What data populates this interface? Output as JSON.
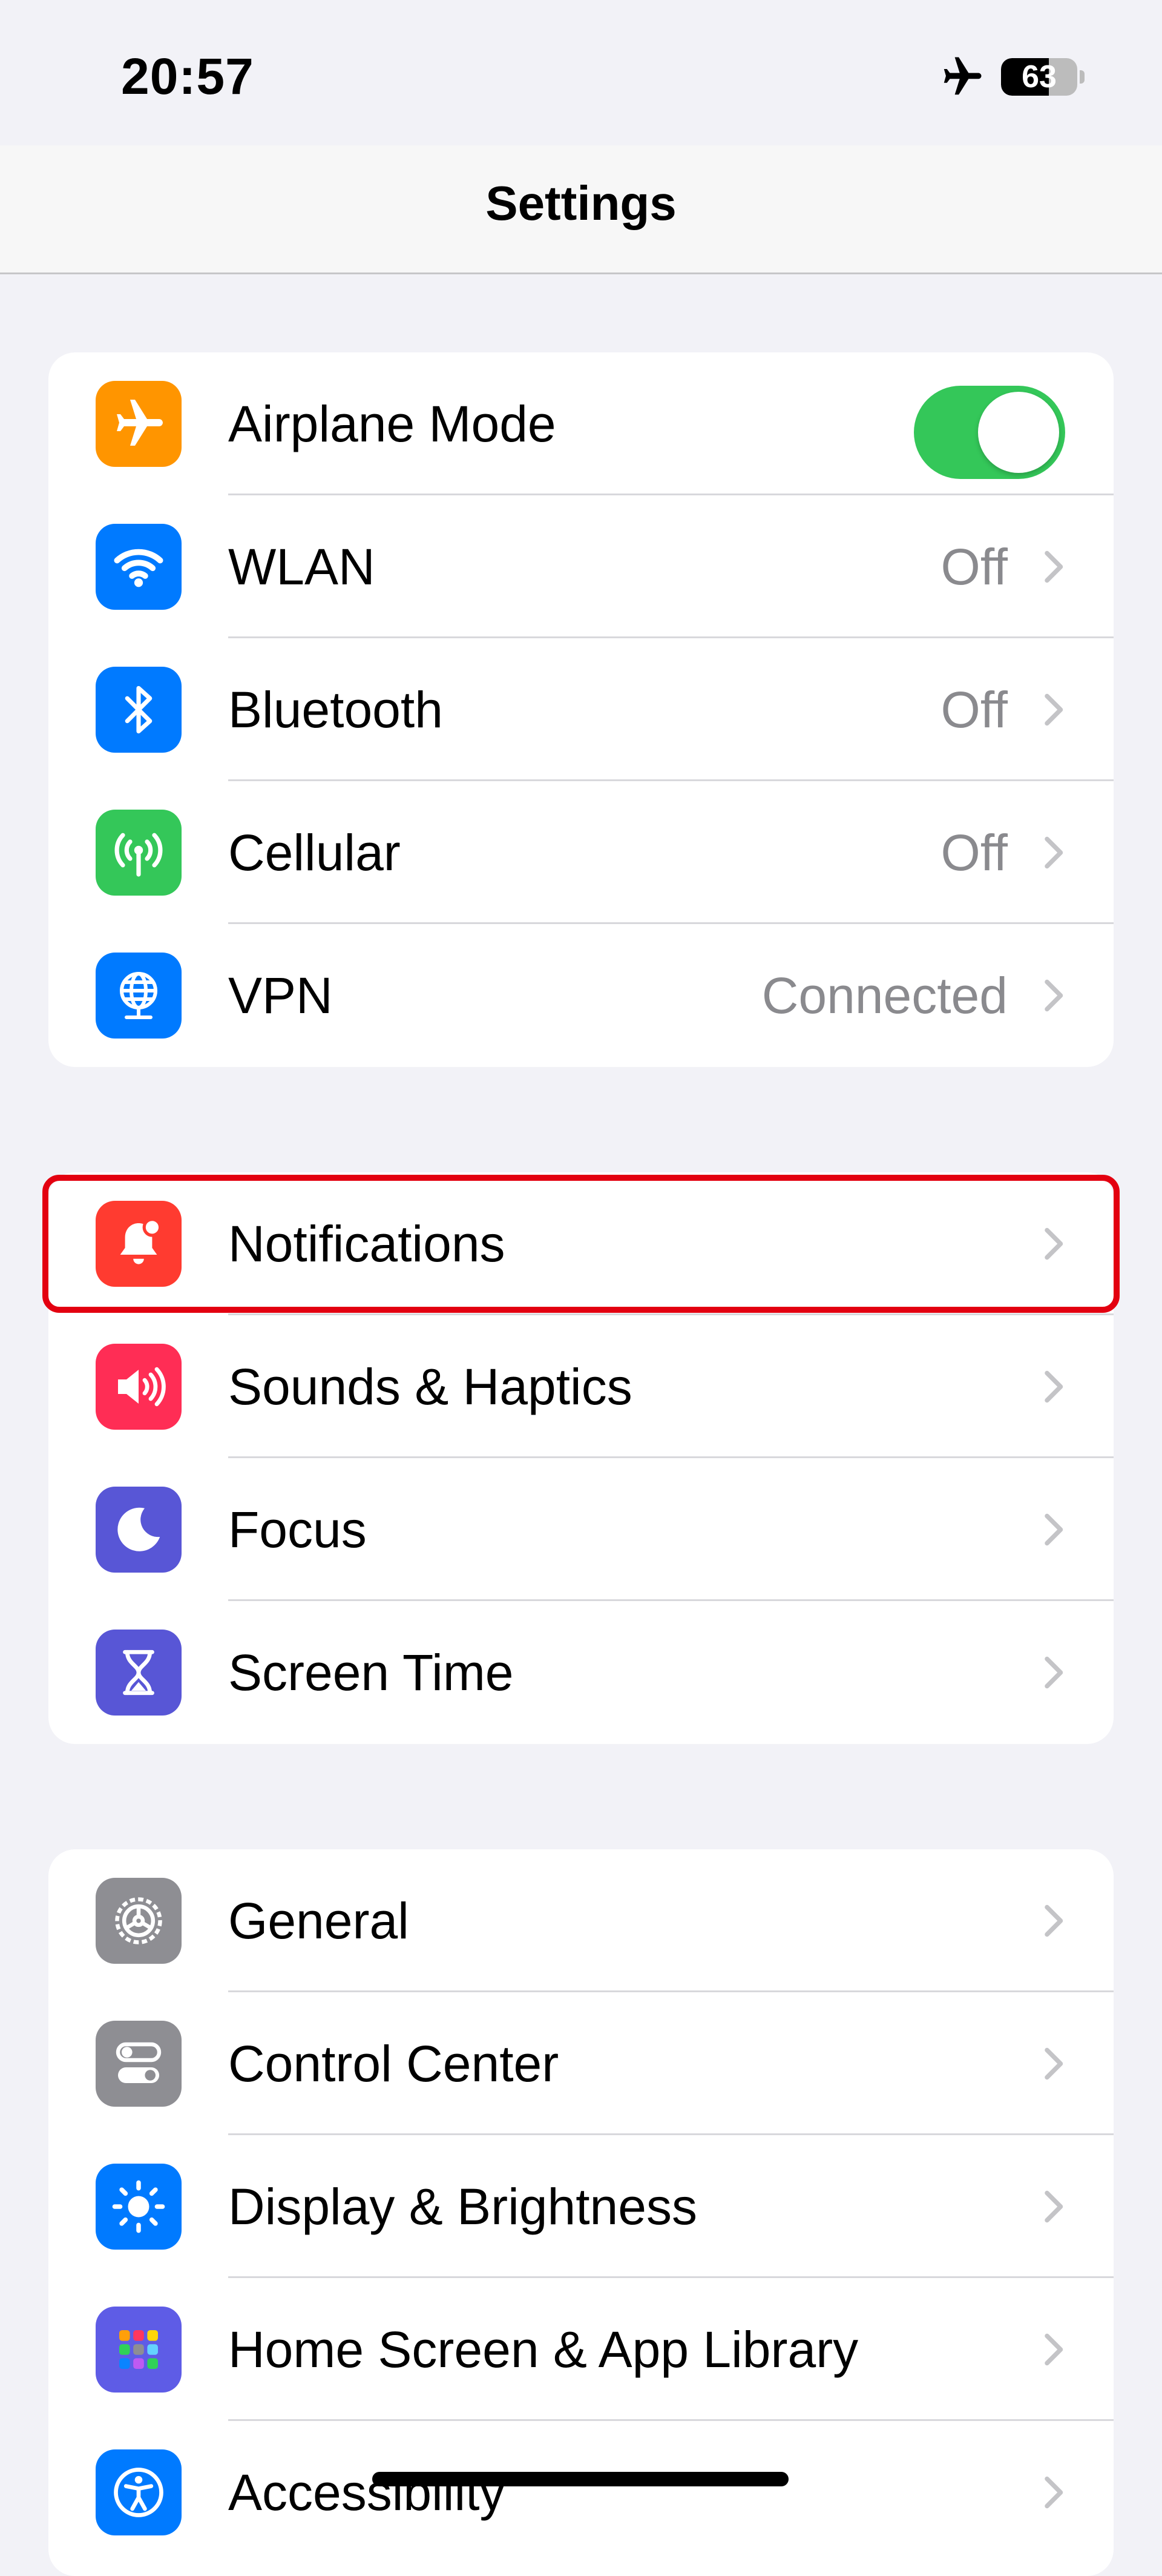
{
  "status_bar": {
    "time": "20:57",
    "battery_level": "63",
    "battery_fraction": 0.63,
    "airplane_icon": "airplane-icon"
  },
  "nav": {
    "title": "Settings"
  },
  "groups": [
    {
      "rows": [
        {
          "label": "Airplane Mode",
          "icon": "airplane-icon",
          "color": "#ff9500",
          "toggle_on": true
        },
        {
          "label": "WLAN",
          "value": "Off",
          "icon": "wifi-icon",
          "color": "#007aff"
        },
        {
          "label": "Bluetooth",
          "value": "Off",
          "icon": "bluetooth-icon",
          "color": "#007aff"
        },
        {
          "label": "Cellular",
          "value": "Off",
          "icon": "cellular-icon",
          "color": "#34c759"
        },
        {
          "label": "VPN",
          "value": "Connected",
          "icon": "vpn-globe-icon",
          "color": "#007aff"
        }
      ]
    },
    {
      "rows": [
        {
          "label": "Notifications",
          "icon": "bell-icon",
          "color": "#ff3b30",
          "highlighted": true
        },
        {
          "label": "Sounds & Haptics",
          "icon": "speaker-icon",
          "color": "#ff2d55"
        },
        {
          "label": "Focus",
          "icon": "moon-icon",
          "color": "#5856d6"
        },
        {
          "label": "Screen Time",
          "icon": "hourglass-icon",
          "color": "#5856d6"
        }
      ]
    },
    {
      "rows": [
        {
          "label": "General",
          "icon": "gear-icon",
          "color": "#8e8e93"
        },
        {
          "label": "Control Center",
          "icon": "switches-icon",
          "color": "#8e8e93"
        },
        {
          "label": "Display & Brightness",
          "icon": "sun-icon",
          "color": "#007aff"
        },
        {
          "label": "Home Screen & App Library",
          "icon": "app-grid-icon",
          "color": "#5e5ce6"
        },
        {
          "label": "Accessibility",
          "icon": "accessibility-icon",
          "color": "#007aff"
        }
      ]
    }
  ],
  "highlight_color": "#e30010"
}
